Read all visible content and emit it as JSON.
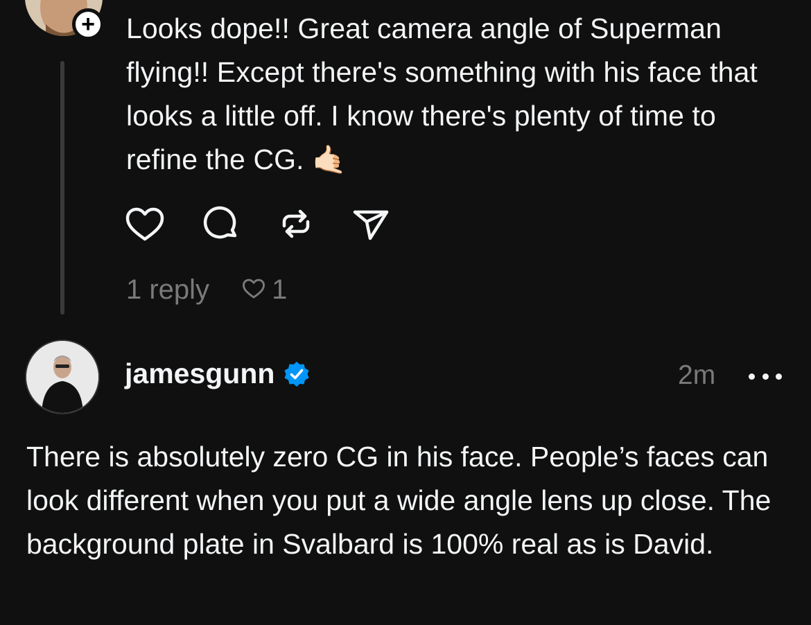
{
  "first_post": {
    "text": "Looks dope!! Great camera angle of Superman flying!! Except there's something with his face that looks a little off. I know there's plenty of time to refine the CG.",
    "emoji": "🤙🏻",
    "follow_badge": "+",
    "actions": [
      "heart-icon",
      "comment-icon",
      "repost-icon",
      "share-icon"
    ],
    "reply_count": "1 reply",
    "like_count": "1"
  },
  "reply_post": {
    "username": "jamesgunn",
    "verified": true,
    "time": "2m",
    "text": "There is absolutely zero CG in his face. People’s faces can look different when you put a wide angle lens up close. The background plate in Svalbard is 100% real as is David."
  },
  "colors": {
    "background": "#101010",
    "text": "#f3f5f7",
    "muted": "#7a7a7a",
    "verified": "#0095f6"
  }
}
